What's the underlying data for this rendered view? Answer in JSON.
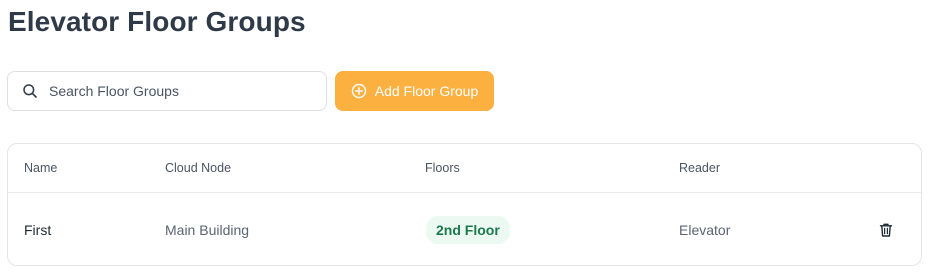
{
  "page": {
    "title": "Elevator Floor Groups"
  },
  "toolbar": {
    "search_placeholder": "Search Floor Groups",
    "search_value": "",
    "search_icon": "search-icon",
    "add_label": "Add Floor Group",
    "add_icon": "plus-circle-icon"
  },
  "table": {
    "columns": [
      "Name",
      "Cloud Node",
      "Floors",
      "Reader"
    ],
    "rows": [
      {
        "name": "First",
        "cloud_node": "Main Building",
        "floors": "2nd Floor",
        "reader": "Elevator",
        "action_icon": "trash-icon"
      }
    ]
  },
  "colors": {
    "accent": "#fbb040",
    "title": "#2f3a48",
    "badge_bg": "#ecf8f2",
    "badge_text": "#1c7a4d"
  }
}
